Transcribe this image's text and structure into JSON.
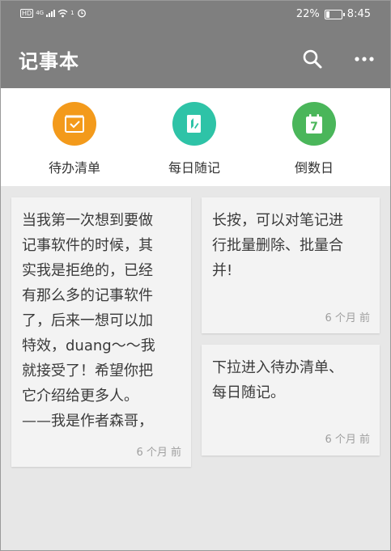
{
  "status_bar": {
    "hd": "HD",
    "network": "4G",
    "extra": "1",
    "battery_percent": "22%",
    "battery_level": 0.22,
    "time": "8:45"
  },
  "app_bar": {
    "title": "记事本",
    "icons": [
      "search-icon",
      "more-icon"
    ]
  },
  "shortcuts": [
    {
      "label": "待办清单",
      "color": "#f39a1b",
      "icon": "checklist-icon"
    },
    {
      "label": "每日随记",
      "color": "#2ec3a7",
      "icon": "diary-icon"
    },
    {
      "label": "倒数日",
      "color": "#4ab65a",
      "icon": "calendar-icon",
      "icon_text": "7"
    }
  ],
  "notes": [
    {
      "text": "当我第一次想到要做\n记事软件的时候，其\n实我是拒绝的，已经\n有那么多的记事软件\n了，后来一想可以加\n特效，duang～～我\n就接受了！希望你把\n它介绍给更多人。\n——我是作者森哥，",
      "date": "6 个月 前"
    },
    {
      "text": "长按，可以对笔记进\n行批量删除、批量合\n并!",
      "date": "6 个月 前"
    },
    {
      "text": "下拉进入待办清单、\n每日随记。",
      "date": "6 个月 前"
    }
  ]
}
